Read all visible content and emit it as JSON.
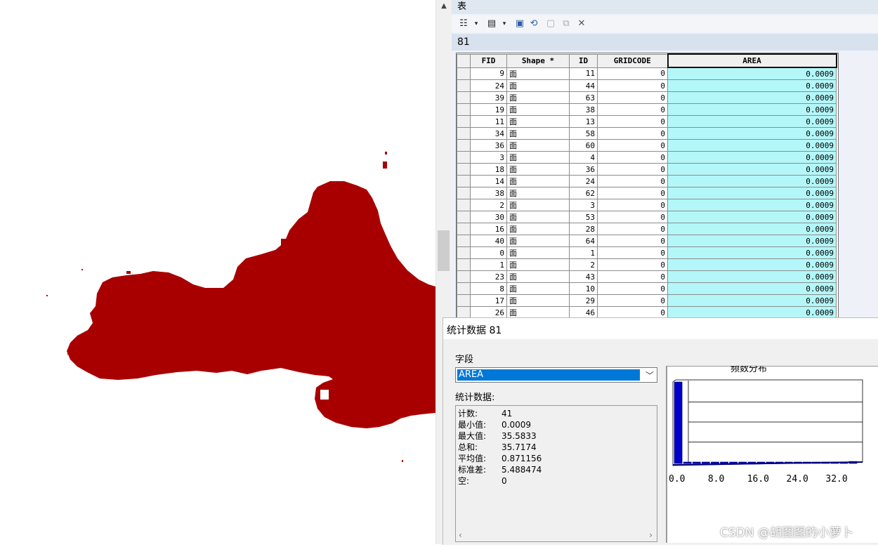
{
  "table_window": {
    "title": "表",
    "layer_name": "81",
    "columns": [
      "",
      "FID",
      "Shape *",
      "ID",
      "GRIDCODE",
      "AREA"
    ],
    "rows": [
      {
        "fid": "9",
        "shape": "面",
        "id": "11",
        "gridcode": "0",
        "area": "0.0009"
      },
      {
        "fid": "24",
        "shape": "面",
        "id": "44",
        "gridcode": "0",
        "area": "0.0009"
      },
      {
        "fid": "39",
        "shape": "面",
        "id": "63",
        "gridcode": "0",
        "area": "0.0009"
      },
      {
        "fid": "19",
        "shape": "面",
        "id": "38",
        "gridcode": "0",
        "area": "0.0009"
      },
      {
        "fid": "11",
        "shape": "面",
        "id": "13",
        "gridcode": "0",
        "area": "0.0009"
      },
      {
        "fid": "34",
        "shape": "面",
        "id": "58",
        "gridcode": "0",
        "area": "0.0009"
      },
      {
        "fid": "36",
        "shape": "面",
        "id": "60",
        "gridcode": "0",
        "area": "0.0009"
      },
      {
        "fid": "3",
        "shape": "面",
        "id": "4",
        "gridcode": "0",
        "area": "0.0009"
      },
      {
        "fid": "18",
        "shape": "面",
        "id": "36",
        "gridcode": "0",
        "area": "0.0009"
      },
      {
        "fid": "14",
        "shape": "面",
        "id": "24",
        "gridcode": "0",
        "area": "0.0009"
      },
      {
        "fid": "38",
        "shape": "面",
        "id": "62",
        "gridcode": "0",
        "area": "0.0009"
      },
      {
        "fid": "2",
        "shape": "面",
        "id": "3",
        "gridcode": "0",
        "area": "0.0009"
      },
      {
        "fid": "30",
        "shape": "面",
        "id": "53",
        "gridcode": "0",
        "area": "0.0009"
      },
      {
        "fid": "16",
        "shape": "面",
        "id": "28",
        "gridcode": "0",
        "area": "0.0009"
      },
      {
        "fid": "40",
        "shape": "面",
        "id": "64",
        "gridcode": "0",
        "area": "0.0009"
      },
      {
        "fid": "0",
        "shape": "面",
        "id": "1",
        "gridcode": "0",
        "area": "0.0009"
      },
      {
        "fid": "1",
        "shape": "面",
        "id": "2",
        "gridcode": "0",
        "area": "0.0009"
      },
      {
        "fid": "23",
        "shape": "面",
        "id": "43",
        "gridcode": "0",
        "area": "0.0009"
      },
      {
        "fid": "8",
        "shape": "面",
        "id": "10",
        "gridcode": "0",
        "area": "0.0009"
      },
      {
        "fid": "17",
        "shape": "面",
        "id": "29",
        "gridcode": "0",
        "area": "0.0009"
      },
      {
        "fid": "26",
        "shape": "面",
        "id": "46",
        "gridcode": "0",
        "area": "0.0009"
      }
    ]
  },
  "stats_dialog": {
    "title": "统计数据 81",
    "field_label": "字段",
    "field_value": "AREA",
    "stats_label": "统计数据:",
    "stats": [
      {
        "key": "计数:",
        "value": "41"
      },
      {
        "key": "最小值:",
        "value": "0.0009"
      },
      {
        "key": "最大值:",
        "value": "35.5833"
      },
      {
        "key": "总和:",
        "value": "35.7174"
      },
      {
        "key": "平均值:",
        "value": "0.871156"
      },
      {
        "key": "标准差:",
        "value": "5.488474"
      },
      {
        "key": "空:",
        "value": "0"
      }
    ],
    "histogram_title": "频数分布"
  },
  "chart_data": {
    "type": "bar",
    "title": "频数分布",
    "x_tick_labels": [
      "0.0",
      "8.0",
      "16.0",
      "24.0",
      "32.0"
    ],
    "xlim": [
      0,
      35.5833
    ],
    "bin_count": 20,
    "values": [
      40,
      0,
      0,
      0,
      0,
      0,
      0,
      0,
      0,
      0,
      0,
      0,
      0,
      0,
      0,
      0,
      0,
      0,
      0,
      1
    ],
    "bar_color": "#0000c8"
  },
  "map": {
    "fill_color": "#a80000"
  },
  "watermark": "CSDN @胡图图的小萝卜"
}
